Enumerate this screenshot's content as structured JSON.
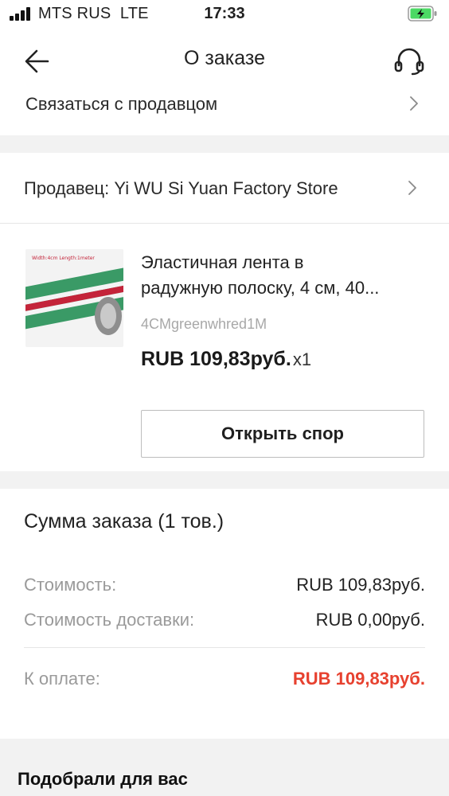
{
  "status_bar": {
    "carrier": "MTS RUS",
    "network": "LTE",
    "time": "17:33"
  },
  "header": {
    "title": "О заказе"
  },
  "contact_seller": {
    "label": "Связаться с продавцом"
  },
  "seller": {
    "label": "Продавец: Yi WU Si Yuan Factory Store"
  },
  "product": {
    "title_line1": "Эластичная лента в",
    "title_line2": "радужную полоску, 4 см, 40...",
    "sku": "4CMgreenwhred1M",
    "price": "RUB 109,83руб.",
    "quantity": "x1",
    "colors": {
      "green": "#3a9a66",
      "white": "#f4f4f4",
      "red": "#c4243a",
      "gray": "#8e8e8e"
    }
  },
  "actions": {
    "open_dispute": "Открыть спор"
  },
  "summary": {
    "title": "Сумма заказа (1 тов.)",
    "cost_label": "Стоимость:",
    "cost_value": "RUB 109,83руб.",
    "shipping_label": "Стоимость доставки:",
    "shipping_value": "RUB 0,00руб.",
    "total_label": "К оплате:",
    "total_value": "RUB 109,83руб."
  },
  "recommendations": {
    "title": "Подобрали для вас"
  },
  "theme": {
    "accent_red": "#e7412f",
    "battery_green": "#4cd964",
    "band_gray": "#f2f2f2"
  }
}
